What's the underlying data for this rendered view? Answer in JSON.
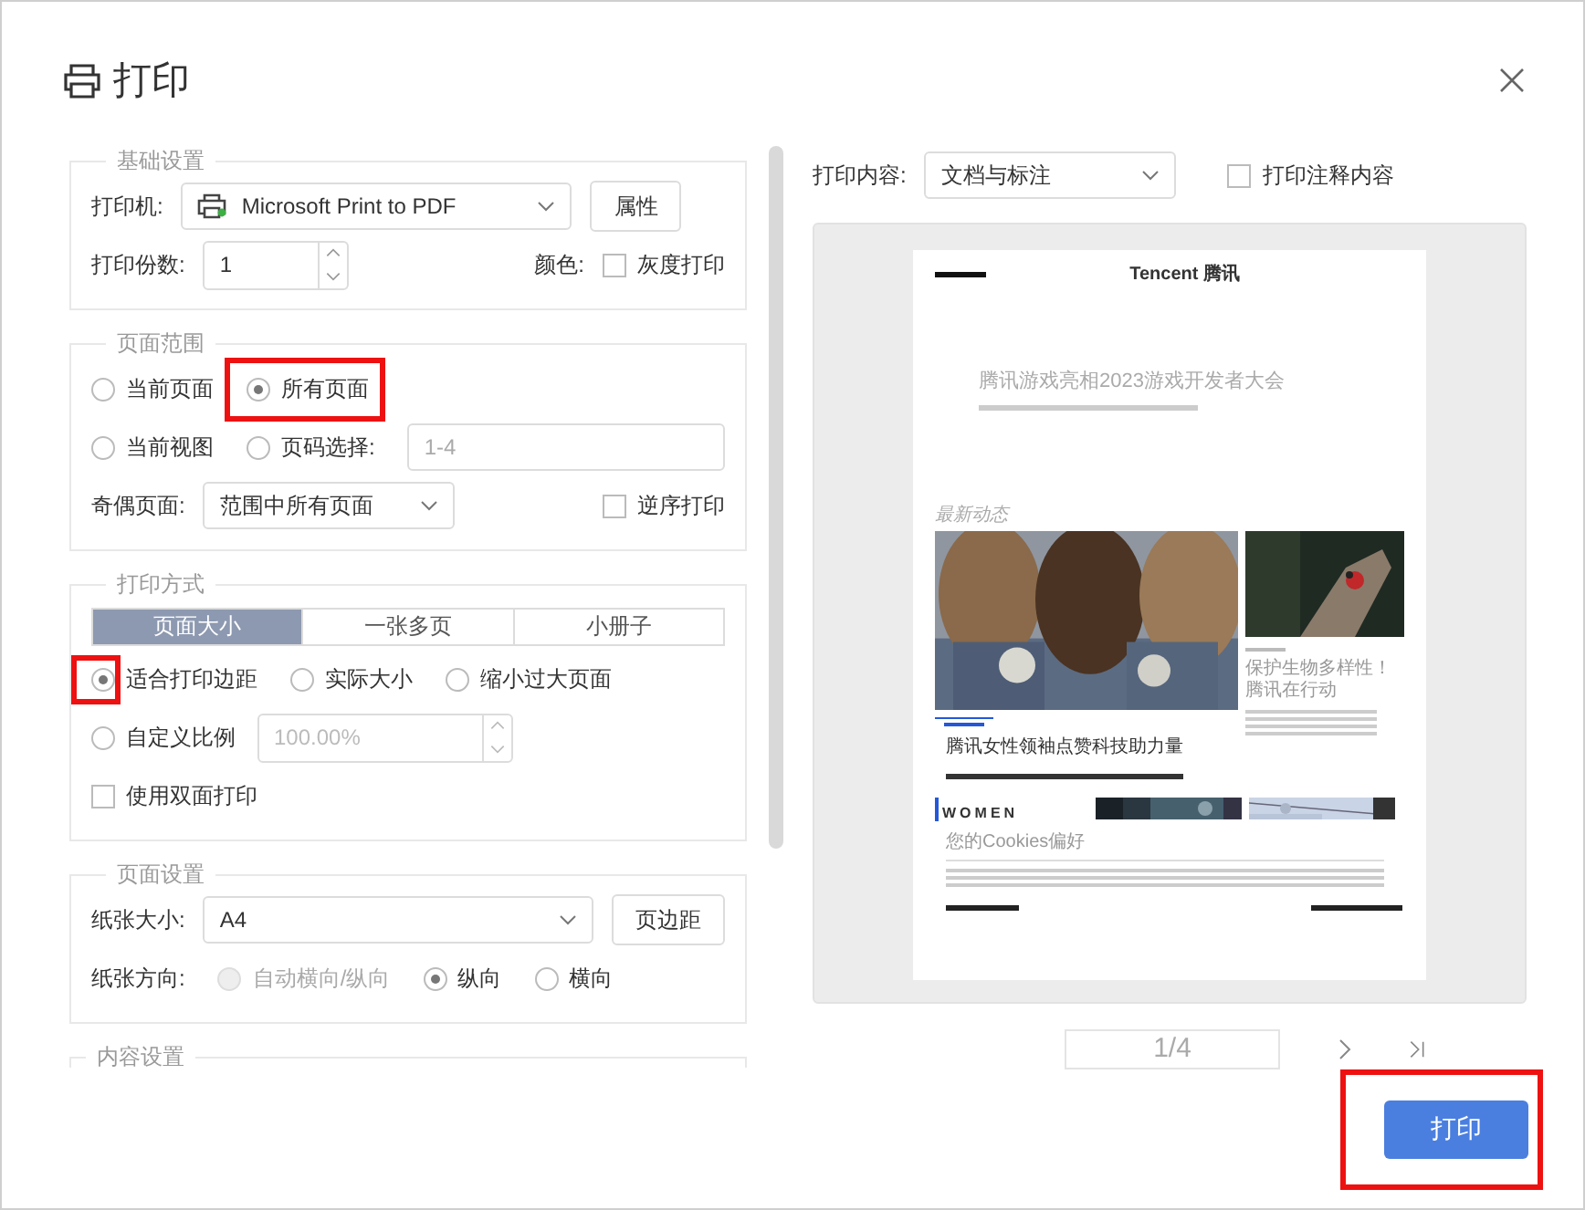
{
  "window": {
    "title": "打印"
  },
  "basic": {
    "legend": "基础设置",
    "printer_label": "打印机:",
    "printer": "Microsoft Print to PDF",
    "properties_button": "属性",
    "copies_label": "打印份数:",
    "copies": "1",
    "color_label": "颜色:",
    "grayscale": {
      "label": "灰度打印",
      "checked": false
    }
  },
  "page_range": {
    "legend": "页面范围",
    "options": [
      {
        "label": "当前页面",
        "selected": false,
        "highlighted": false
      },
      {
        "label": "所有页面",
        "selected": true,
        "highlighted": true
      },
      {
        "label": "当前视图",
        "selected": false,
        "highlighted": false
      },
      {
        "label": "页码选择:",
        "selected": false,
        "highlighted": false
      }
    ],
    "page_field": {
      "placeholder": "1-4"
    },
    "odd_even_label": "奇偶页面:",
    "odd_even": "范围中所有页面",
    "reverse": {
      "label": "逆序打印",
      "checked": false
    }
  },
  "print_mode": {
    "legend": "打印方式",
    "tabs": [
      {
        "label": "页面大小",
        "selected": true
      },
      {
        "label": "一张多页",
        "selected": false
      },
      {
        "label": "小册子",
        "selected": false
      }
    ],
    "scale_options": [
      {
        "label": "适合打印边距",
        "selected": true,
        "highlighted": true
      },
      {
        "label": "实际大小",
        "selected": false,
        "highlighted": false
      },
      {
        "label": "缩小过大页面",
        "selected": false,
        "highlighted": false
      },
      {
        "label": "自定义比例",
        "selected": false,
        "highlighted": false
      }
    ],
    "custom_scale": {
      "value": "100.00%",
      "disabled": true
    },
    "duplex": {
      "label": "使用双面打印",
      "checked": false
    }
  },
  "page_setup": {
    "legend": "页面设置",
    "paper_label": "纸张大小:",
    "paper": "A4",
    "margins_button": "页边距",
    "orientation_label": "纸张方向:",
    "orientations": [
      {
        "label": "自动横向/纵向",
        "selected": false,
        "disabled": true
      },
      {
        "label": "纵向",
        "selected": true,
        "disabled": false
      },
      {
        "label": "横向",
        "selected": false,
        "disabled": false
      }
    ]
  },
  "content_settings": {
    "legend": "内容设置"
  },
  "preview": {
    "content_label": "打印内容:",
    "content": "文档与标注",
    "print_comments": {
      "label": "打印注释内容",
      "checked": false
    },
    "document": {
      "header": "Tencent 腾讯",
      "title": "腾讯游戏亮相2023游戏开发者大会",
      "section": "最新动态",
      "main_headline": "腾讯女性领袖点赞科技助力量",
      "side_headline": "保护生物多样性！腾讯在行动",
      "banner": "WOMEN",
      "cookies_heading": "您的Cookies偏好"
    },
    "page_indicator": "1/4"
  },
  "print_button": {
    "label": "打印",
    "highlighted": true
  }
}
